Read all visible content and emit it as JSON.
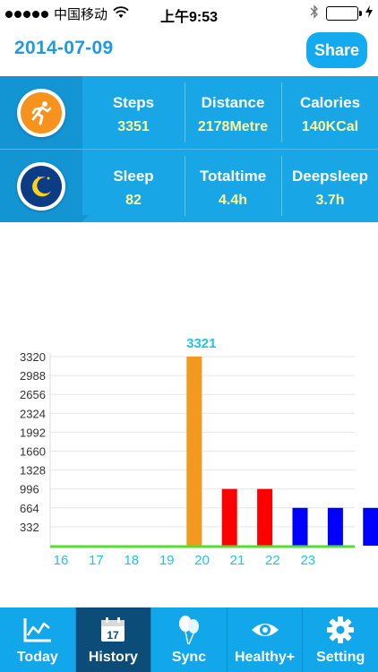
{
  "status_bar": {
    "carrier": "中国移动",
    "time": "上午9:53"
  },
  "header": {
    "date": "2014-07-09",
    "share_label": "Share"
  },
  "stats": {
    "activity_icon": "running-icon",
    "sleep_icon": "moon-icon",
    "row1": [
      {
        "label": "Steps",
        "value": "3351"
      },
      {
        "label": "Distance",
        "value": "2178Metre"
      },
      {
        "label": "Calories",
        "value": "140KCal"
      }
    ],
    "row2": [
      {
        "label": "Sleep",
        "value": "82"
      },
      {
        "label": "Totaltime",
        "value": "4.4h"
      },
      {
        "label": "Deepsleep",
        "value": "3.7h"
      }
    ]
  },
  "chart_data": {
    "type": "bar",
    "title": "",
    "xlabel": "",
    "ylabel": "",
    "categories": [
      "16",
      "17",
      "18",
      "19",
      "20",
      "21",
      "22",
      "23"
    ],
    "values": [
      0,
      0,
      3321,
      996,
      996,
      664,
      664,
      664
    ],
    "bar_colors": [
      "#f39a1e",
      "#f39a1e",
      "#f39a1e",
      "#ff0000",
      "#ff0000",
      "#0000ff",
      "#0000ff",
      "#0000ff"
    ],
    "y_ticks": [
      "332",
      "664",
      "996",
      "1328",
      "1660",
      "1992",
      "2324",
      "2656",
      "2988",
      "3320"
    ],
    "ylim": [
      0,
      3320
    ],
    "peak_label": "3321",
    "grid": true
  },
  "tabbar": {
    "tabs": [
      {
        "label": "Today",
        "icon": "line-chart-icon"
      },
      {
        "label": "History",
        "icon": "calendar-icon",
        "icon_text": "17"
      },
      {
        "label": "Sync",
        "icon": "balloons-icon"
      },
      {
        "label": "Healthy+",
        "icon": "eye-icon"
      },
      {
        "label": "Setting",
        "icon": "gear-icon"
      }
    ],
    "active": "History"
  },
  "colors": {
    "accent": "#13aaf0",
    "panel": "#19a6e6",
    "value_text": "#fff99a",
    "axis_label": "#1ec5e6",
    "baseline": "#55dd33"
  }
}
